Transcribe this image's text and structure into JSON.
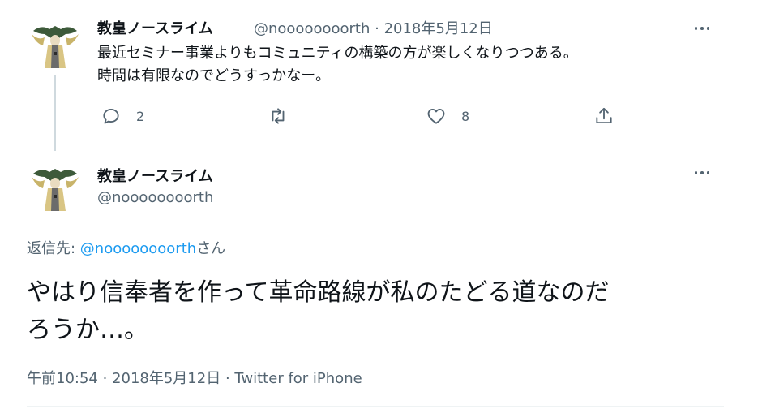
{
  "tweet1": {
    "name": "教皇ノースライム",
    "handle": "@noooooooorth",
    "date_sep": " · ",
    "date": "2018年5月12日",
    "text_line1": "最近セミナー事業よりもコミュニティの構築の方が楽しくなりつつある。",
    "text_line2": "時間は有限なのでどうすっかなー。",
    "reply_count": "2",
    "like_count": "8",
    "icons": [
      "reply-icon",
      "retweet-icon",
      "like-icon",
      "share-icon",
      "more-icon"
    ]
  },
  "tweet2": {
    "name": "教皇ノースライム",
    "handle": "@noooooooorth",
    "reply_prefix": "返信先: ",
    "reply_handle": "@noooooooorth",
    "reply_suffix": "さん",
    "text_line1": "やはり信奉者を作って革命路線が私のたどる道なのだ",
    "text_line2": "ろうか…。",
    "time": "午前10:54",
    "sep": " · ",
    "date": "2018年5月12日",
    "source": "Twitter for iPhone"
  },
  "colors": {
    "text": "#0f1419",
    "secondary": "#536471",
    "link": "#1d9bf0",
    "thread_line": "#cfd9de"
  }
}
